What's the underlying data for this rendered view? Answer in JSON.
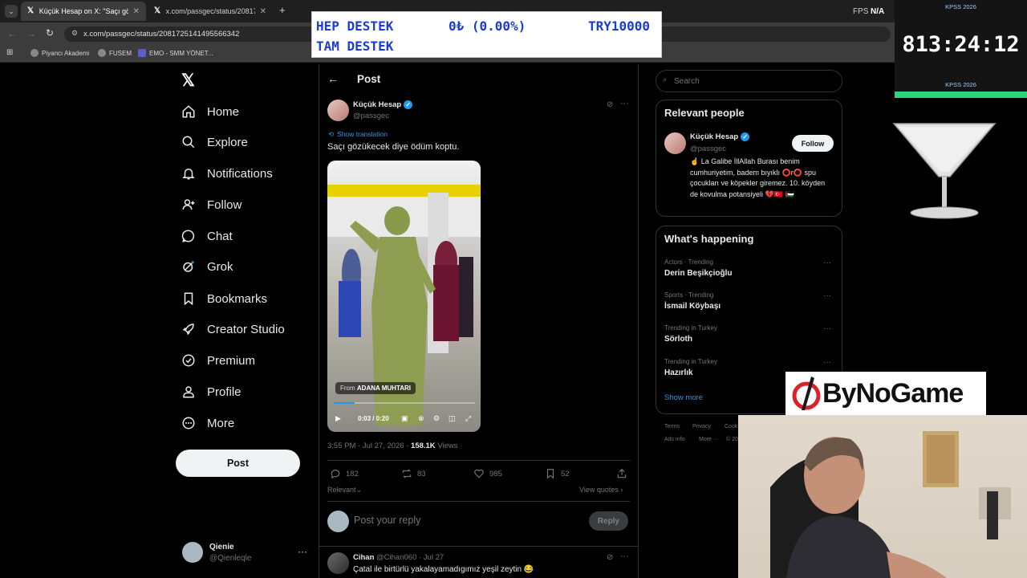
{
  "browser": {
    "tabs": [
      {
        "title": "Küçük Hesap on X: \"Saçı gözük",
        "active": true
      },
      {
        "title": "x.com/passgec/status/20817281",
        "active": false
      }
    ],
    "new_tab": "+",
    "url": "x.com/passgec/status/2081725141495566342",
    "fps_label": "FPS",
    "fps_value": "N/A",
    "bookmarks": [
      "Piyancı Akademi",
      "FUSEM",
      "EMO - SMM YÖNET..."
    ]
  },
  "nav": {
    "items": [
      "Home",
      "Explore",
      "Notifications",
      "Follow",
      "Chat",
      "Grok",
      "Bookmarks",
      "Creator Studio",
      "Premium",
      "Profile",
      "More"
    ],
    "post_button": "Post",
    "account": {
      "name": "Qienie",
      "handle": "@Qienleqle"
    }
  },
  "post": {
    "header": "Post",
    "author_name": "Küçük Hesap",
    "author_handle": "@passgec",
    "show_translation": "Show translation",
    "text": "Saçı gözükecek diye ödüm koptu.",
    "video": {
      "source_prefix": "From",
      "source_name": "ADANA MUHTARI",
      "time": "0:03 / 0:20",
      "progress": 0.15
    },
    "timestamp": "3:55 PM · Jul 27, 2026 ·",
    "views": "158.1K",
    "views_label": "Views",
    "stats": {
      "replies": "182",
      "reposts": "83",
      "likes": "985",
      "bookmarks": "52"
    },
    "sort_label": "Relevant",
    "view_quotes": "View quotes",
    "reply_placeholder": "Post your reply",
    "reply_button": "Reply"
  },
  "reply": {
    "name": "Cihan",
    "handle": "@Cihan060",
    "date": "· Jul 27",
    "text": "Çatal ile birtürlü yakalayamadıgımız yeşil zeytin 😂"
  },
  "sidebar": {
    "search_placeholder": "Search",
    "relevant_title": "Relevant people",
    "person": {
      "name": "Küçük Hesap",
      "handle": "@passgec",
      "follow": "Follow",
      "bio": "☝️ La Galibe İllAllah Burası benim cumhuriyetim, badem bıyıklı ⭕r⭕ spu çocukları ve köpekler giremez. 10. köyden de kovulma potansiyeli 💔🇹🇷 🇵🇸"
    },
    "happening_title": "What's happening",
    "trends": [
      {
        "meta": "Actors · Trending",
        "name": "Derin Beşikçioğlu"
      },
      {
        "meta": "Sports · Trending",
        "name": "İsmail Köybaşı"
      },
      {
        "meta": "Trending in Turkey",
        "name": "Sörloth"
      },
      {
        "meta": "Trending in Turkey",
        "name": "Hazırlık"
      }
    ],
    "show_more": "Show more",
    "footer": [
      "Terms",
      "Privacy",
      "Cook",
      "Ads info",
      "More ···",
      "© 20"
    ]
  },
  "overlay": {
    "ticker_line1_left": "HEP DESTEK",
    "ticker_line1_mid": "0₺ (0.00%)",
    "ticker_line1_right": "TRY10000",
    "ticker_line2": "TAM DESTEK",
    "timer_label_top": "KPSS 2026",
    "timer_value": "813:24:12",
    "timer_label_bottom": "KPSS 2026",
    "brand": "ByNoGame"
  },
  "colors": {
    "accent": "#1d9bf0",
    "ticker_text": "#1a3bd6",
    "timer_green": "#2bd67b"
  }
}
